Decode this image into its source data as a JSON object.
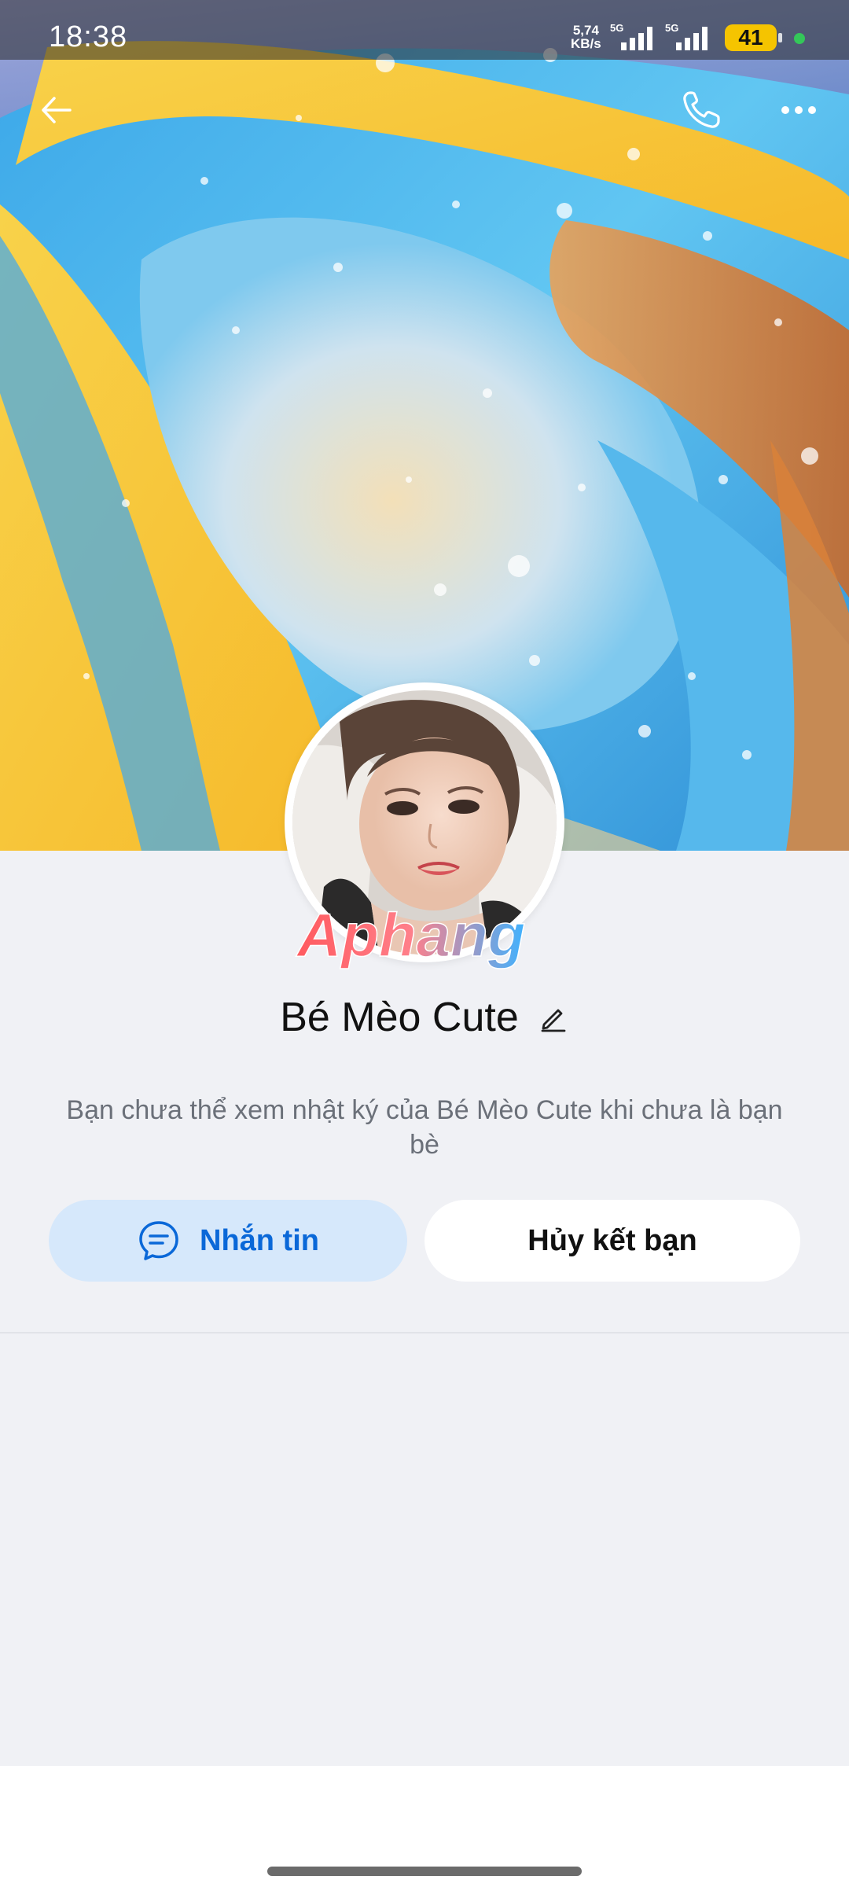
{
  "status_bar": {
    "time": "18:38",
    "speed_value": "5,74",
    "speed_unit": "KB/s",
    "network_1": "5G",
    "network_2": "5G",
    "battery": "41"
  },
  "header": {
    "back_icon": "arrow-left-icon",
    "call_icon": "phone-icon",
    "more_icon": "more-horizontal-icon"
  },
  "profile": {
    "name": "Bé Mèo Cute",
    "watermark": "Aphang",
    "notice": "Bạn chưa thể xem nhật ký của Bé Mèo Cute khi chưa là bạn bè"
  },
  "actions": {
    "message_label": "Nhắn tin",
    "unfriend_label": "Hủy kết bạn"
  },
  "colors": {
    "accent": "#0a68d8",
    "message_button_bg": "#d6e8fb",
    "page_bg": "#f0f1f5",
    "battery": "#f5c400"
  }
}
